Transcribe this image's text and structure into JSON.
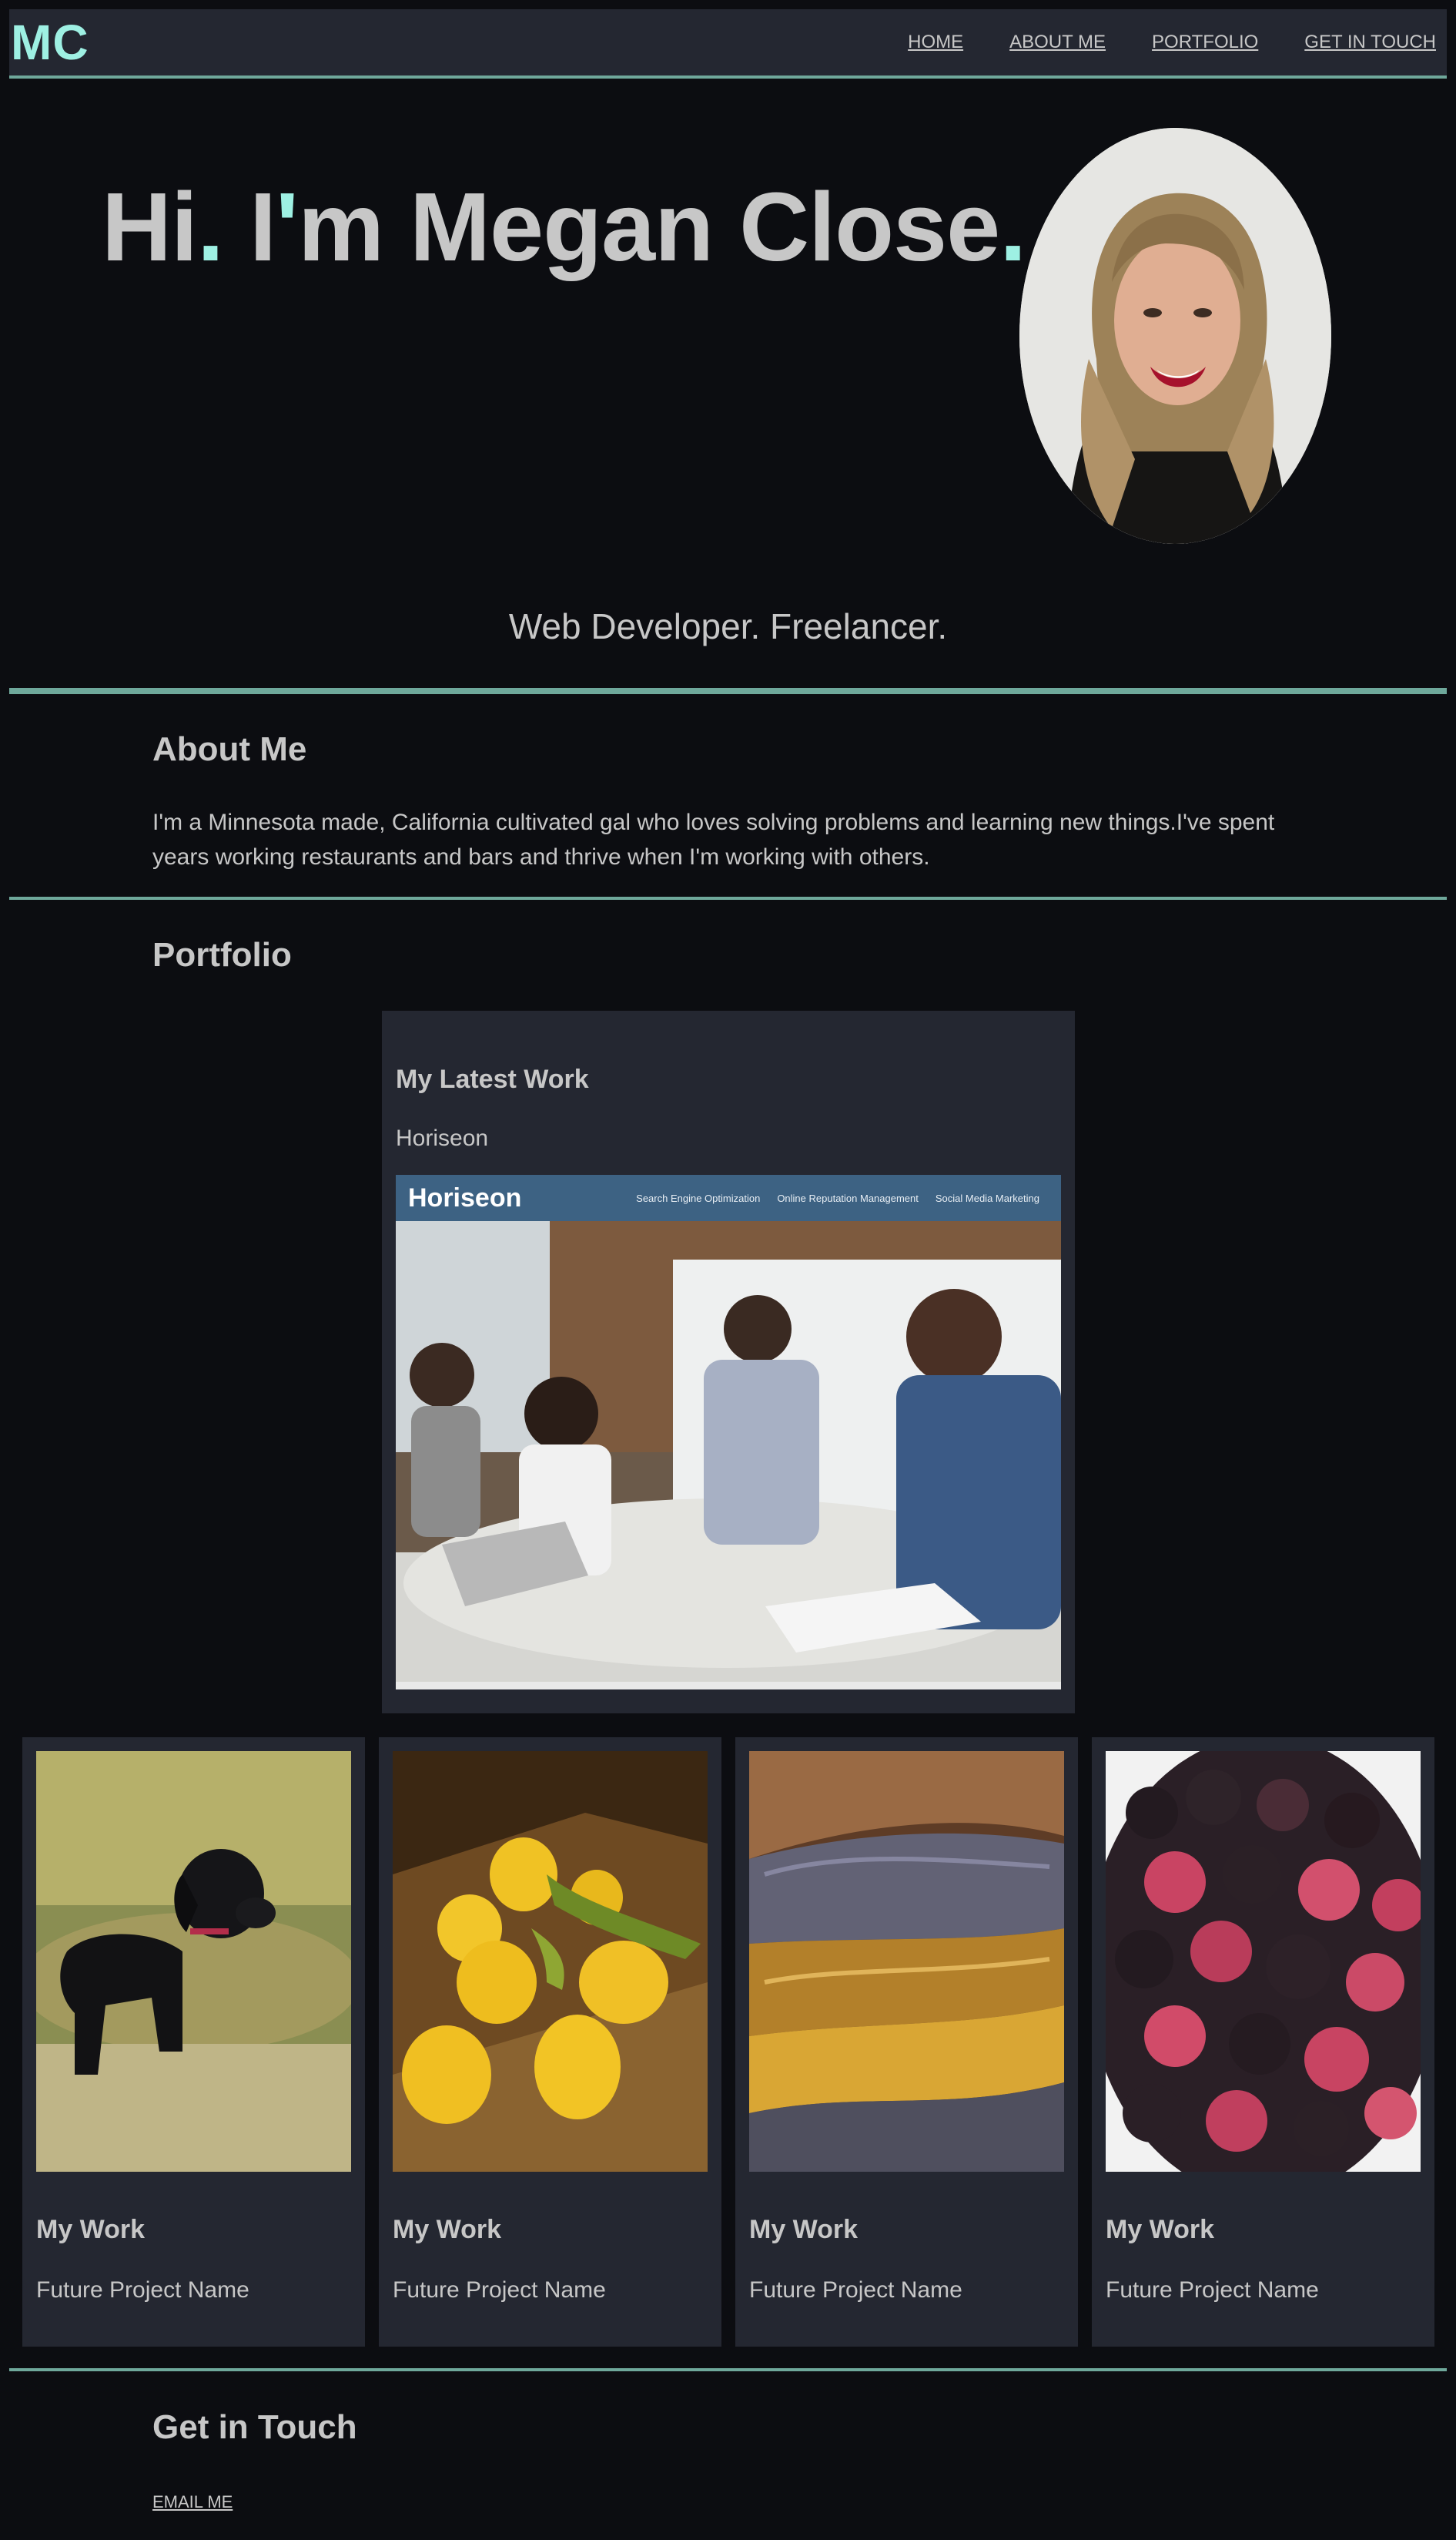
{
  "header": {
    "logo": "MC",
    "nav": [
      "HOME",
      "ABOUT ME",
      "PORTFOLIO",
      "GET IN TOUCH"
    ]
  },
  "hero": {
    "title_part1": "Hi",
    "title_part2": " I",
    "title_part3": "m Megan Close",
    "tagline": "Web Developer. Freelancer."
  },
  "about": {
    "title": "About Me",
    "text": "I'm a Minnesota made, California cultivated gal who loves solving problems and learning new things.I've spent years working restaurants and bars and thrive when I'm working with others."
  },
  "portfolio": {
    "title": "Portfolio",
    "latest": {
      "heading": "My Latest Work",
      "name": "Horiseon",
      "screenshot_brand": "Horiseon",
      "screenshot_links": [
        "Search Engine Optimization",
        "Online Reputation Management",
        "Social Media Marketing"
      ]
    },
    "cards": [
      {
        "heading": "My Work",
        "name": "Future Project Name",
        "image": "black-dog-photo"
      },
      {
        "heading": "My Work",
        "name": "Future Project Name",
        "image": "lemons-photo"
      },
      {
        "heading": "My Work",
        "name": "Future Project Name",
        "image": "knit-blanket-photo"
      },
      {
        "heading": "My Work",
        "name": "Future Project Name",
        "image": "berries-photo"
      }
    ]
  },
  "contact": {
    "title": "Get in Touch",
    "email_label": "EMAIL ME"
  },
  "colors": {
    "background": "#0c0d11",
    "panel": "#242731",
    "accent": "#9ef0e3",
    "divider": "#6fa89b",
    "text": "#c7c7c7"
  }
}
